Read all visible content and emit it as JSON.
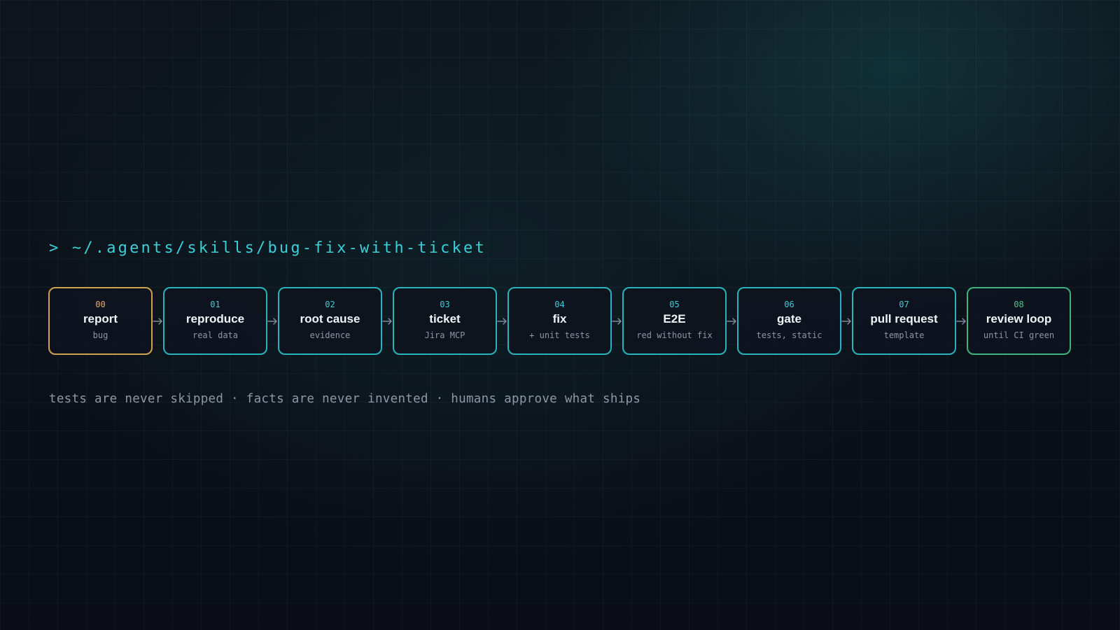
{
  "prompt": "> ~/.agents/skills/bug-fix-with-ticket",
  "steps": [
    {
      "num": "00",
      "title": "report",
      "sub": "bug"
    },
    {
      "num": "01",
      "title": "reproduce",
      "sub": "real data"
    },
    {
      "num": "02",
      "title": "root cause",
      "sub": "evidence"
    },
    {
      "num": "03",
      "title": "ticket",
      "sub": "Jira MCP"
    },
    {
      "num": "04",
      "title": "fix",
      "sub": "+ unit tests"
    },
    {
      "num": "05",
      "title": "E2E",
      "sub": "red without fix"
    },
    {
      "num": "06",
      "title": "gate",
      "sub": "tests, static"
    },
    {
      "num": "07",
      "title": "pull request",
      "sub": "template"
    },
    {
      "num": "08",
      "title": "review loop",
      "sub": "until CI green"
    }
  ],
  "tagline": "tests are never skipped · facts are never invented · humans approve what ships",
  "colors": {
    "accent": "#3ccfd8",
    "start": "#cfa24e",
    "end": "#3fb27d",
    "background": "#0b0f16"
  },
  "icons": {
    "connector": "arrow-right-icon"
  }
}
